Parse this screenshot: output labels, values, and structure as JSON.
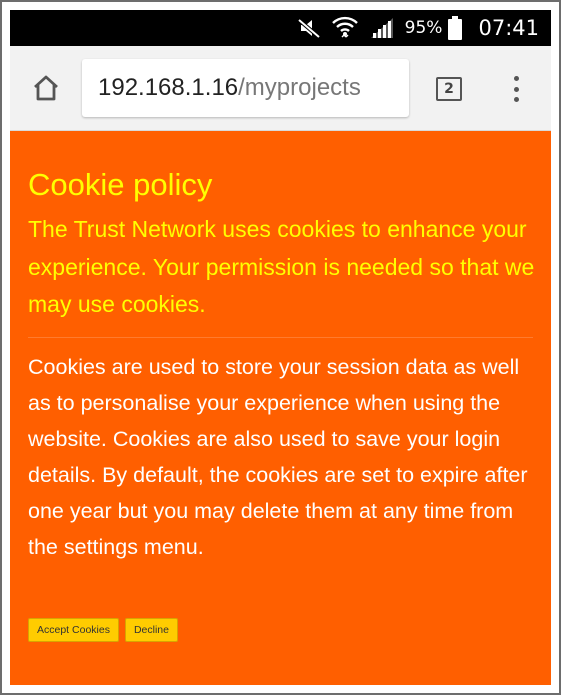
{
  "status_bar": {
    "battery_percent": "95%",
    "time": "07:41",
    "icons": [
      "mute-icon",
      "wifi-icon",
      "signal-icon",
      "battery-icon"
    ]
  },
  "browser": {
    "url_host": "192.168.1.16",
    "url_path": "/myprojects",
    "tab_count": "2",
    "icons": [
      "home-icon",
      "tabs-icon",
      "overflow-menu-icon"
    ]
  },
  "cookie": {
    "title": "Cookie policy",
    "lead": "The Trust Network uses cookies to enhance your experience. Your permission is needed so that we may use cookies.",
    "body": "Cookies are used to store your session data as well as to personalise your experience when using the website. Cookies are also used to save your login details. By default, the cookies are set to expire after one year but you may delete them at any time from the settings menu.",
    "accept_label": "Accept Cookies",
    "decline_label": "Decline"
  },
  "colors": {
    "page_background": "#ff5f00",
    "heading_text": "#ffff00",
    "body_text": "#ffffff",
    "button_background": "#ffcc00",
    "status_bar": "#000000",
    "toolbar": "#f2f2f2"
  }
}
